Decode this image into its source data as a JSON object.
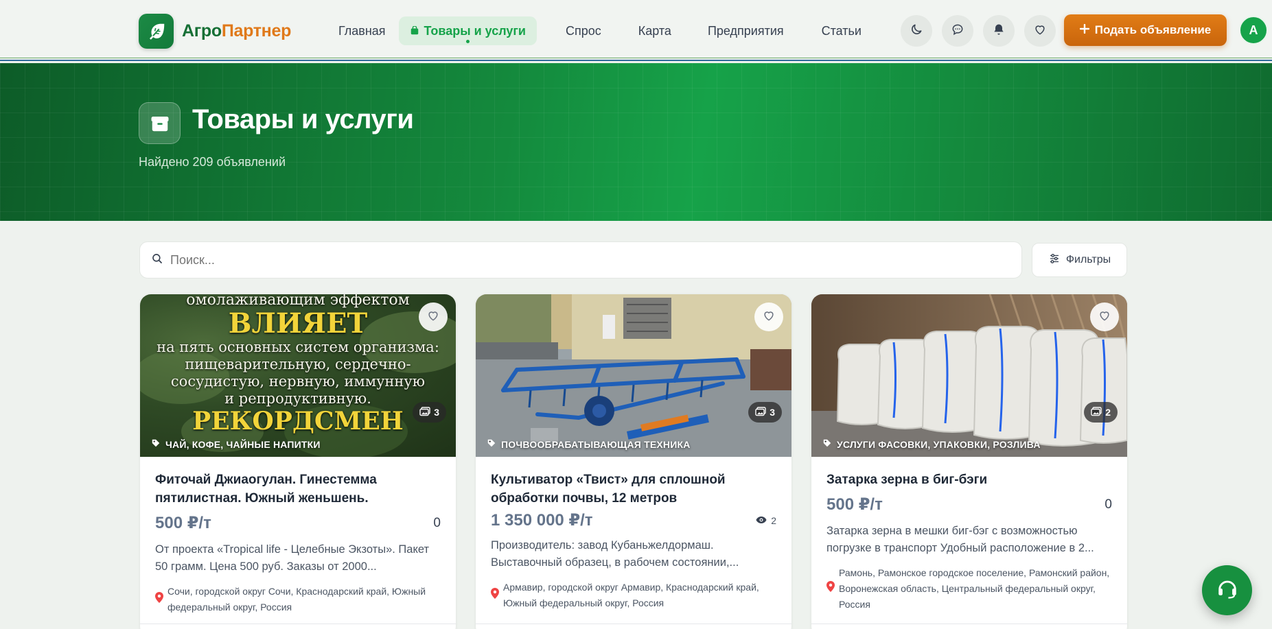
{
  "header": {
    "logo_part1": "Агро",
    "logo_part2": "Партнер",
    "nav": [
      {
        "label": "Главная"
      },
      {
        "label": "Товары и услуги"
      },
      {
        "label": "Спрос"
      },
      {
        "label": "Карта"
      },
      {
        "label": "Предприятия"
      },
      {
        "label": "Статьи"
      }
    ],
    "active_nav": "Товары и услуги",
    "cta_label": "Подать объявление",
    "avatar_letter": "A",
    "accent_color": "#16a34a",
    "cta_color": "#e17c16"
  },
  "hero": {
    "title": "Товары и услуги",
    "subtitle": "Найдено 209 объявлений"
  },
  "search": {
    "placeholder": "Поиск...",
    "filters_label": "Фильтры"
  },
  "cards": [
    {
      "category": "Чай, кофе, чайные напитки",
      "photos": "3",
      "title": "Фиточай Джиаогулан. Гинестемма пятилистная. Южный женьшень.",
      "price": "500 ₽/т",
      "count": "0",
      "description": "От проекта «Tropical life - Целебные Экзоты». Пакет 50 грамм. Цена 500 руб. Заказы от 2000...",
      "location": "Сочи, городской округ Сочи, Краснодарский край, Южный федеральный округ, Россия",
      "image_text": [
        "омолаживающим эффектом",
        "ВЛИЯЕТ",
        "на пять основных систем организма:",
        "пищеварительную, сердечно-",
        "сосудистую, нервную, иммунную",
        "и репродуктивную.",
        "РЕКОРДСМЕН"
      ]
    },
    {
      "category": "Почвообрабатывающая техника",
      "photos": "3",
      "title": "Культиватор «Твист» для сплошной обработки почвы, 12 метров",
      "price": "1 350 000 ₽/т",
      "views": "2",
      "description": "Производитель: завод Кубаньжелдормаш. Выставочный образец, в рабочем состоянии,...",
      "location": "Армавир, городской округ Армавир, Краснодарский край, Южный федеральный округ, Россия"
    },
    {
      "category": "Услуги фасовки, упаковки, розлива",
      "photos": "2",
      "title": "Затарка зерна в биг-бэги",
      "price": "500 ₽/т",
      "count": "0",
      "description": "Затарка зерна в мешки биг-бэг с возможностью погрузке в транспорт Удобный расположение в 2...",
      "location": "Рамонь, Рамонское городское поселение, Рамонский район, Воронежская область, Центральный федеральный округ, Россия"
    }
  ]
}
